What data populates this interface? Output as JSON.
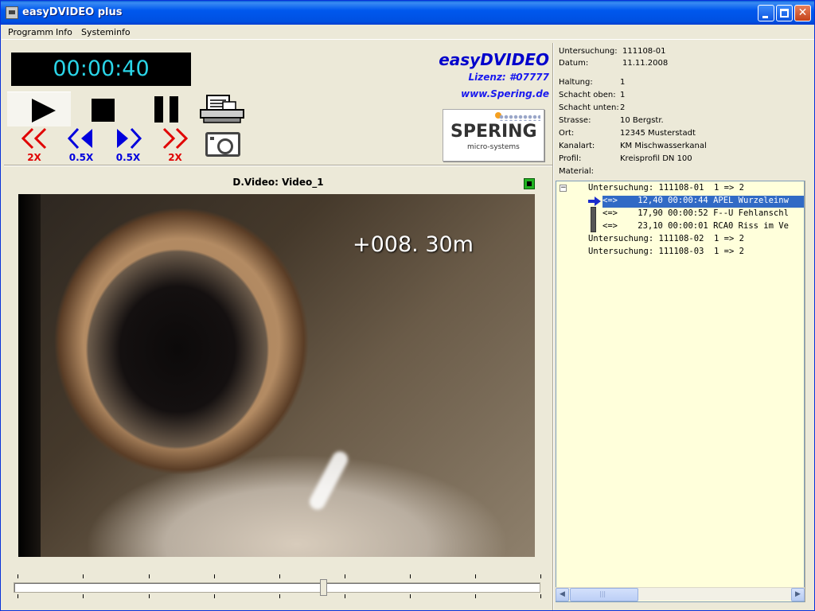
{
  "window": {
    "title": "easyDVIDEO plus"
  },
  "menu": [
    "Programm",
    "Info",
    "Systeminfo"
  ],
  "player": {
    "timer": "00:00:40",
    "speeds": [
      {
        "label": "2X",
        "icon": "rewind-fast-icon",
        "color": "#e00000"
      },
      {
        "label": "0.5X",
        "icon": "rewind-slow-icon",
        "color": "#0000dd"
      },
      {
        "label": "0.5X",
        "icon": "forward-slow-icon",
        "color": "#0000dd"
      },
      {
        "label": "2X",
        "icon": "forward-fast-icon",
        "color": "#e00000"
      }
    ]
  },
  "brand": {
    "title": "easyDVIDEO",
    "license": "Lizenz: #07777",
    "url": "www.Spering.de",
    "logo_word": "SPERING",
    "logo_sub": "micro-systems"
  },
  "video": {
    "title": "D.Video: Video_1",
    "overlay": "+008. 30m",
    "position_fraction": 0.59
  },
  "info": [
    {
      "key": "Untersuchung:",
      "value": "111108-01"
    },
    {
      "key": "Datum:",
      "value": "11.11.2008"
    },
    {
      "key": "Haltung:",
      "value": "1"
    },
    {
      "key": "Schacht oben:",
      "value": "1"
    },
    {
      "key": "Schacht unten:",
      "value": "2"
    },
    {
      "key": "Strasse:",
      "value": "10 Bergstr."
    },
    {
      "key": "Ort:",
      "value": "12345 Musterstadt"
    },
    {
      "key": "Kanalart:",
      "value": "KM Mischwasserkanal"
    },
    {
      "key": "Profil:",
      "value": "Kreisprofil DN 100"
    },
    {
      "key": "Material:",
      "value": ""
    }
  ],
  "tree": {
    "rows": [
      {
        "text": "Untersuchung: 111108-01  1 => 2",
        "level": 0,
        "selected": false
      },
      {
        "text": "<=>    12,40 00:00:44 APEL Wurzeleinw",
        "level": 1,
        "selected": true
      },
      {
        "text": "<=>    17,90 00:00:52 F--U Fehlanschl",
        "level": 1,
        "selected": false
      },
      {
        "text": "<=>    23,10 00:00:01 RCA0 Riss im Ve",
        "level": 1,
        "selected": false
      },
      {
        "text": "Untersuchung: 111108-02  1 => 2",
        "level": 0,
        "selected": false
      },
      {
        "text": "Untersuchung: 111108-03  1 => 2",
        "level": 0,
        "selected": false
      }
    ],
    "expander": "−"
  },
  "colors": {
    "accent": "#0000cc",
    "timer_text": "#2ad5e8",
    "selection": "#316ac5",
    "tree_bg": "#ffffdb"
  }
}
